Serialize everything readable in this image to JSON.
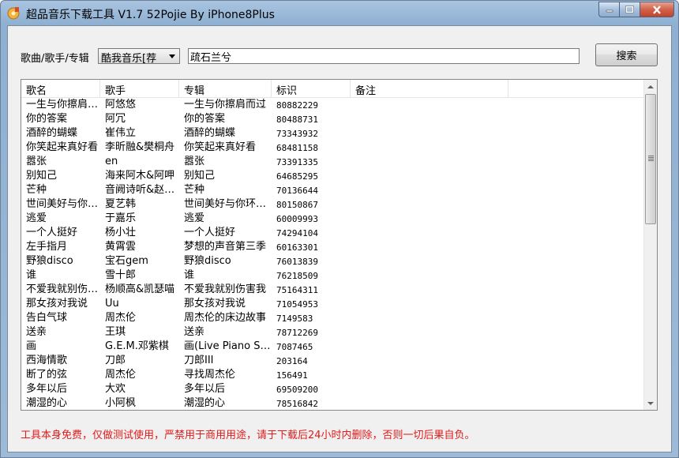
{
  "window": {
    "title": "超品音乐下载工具 V1.7 52Pojie By iPhone8Plus"
  },
  "search": {
    "label": "歌曲/歌手/专辑",
    "source_selected": "酷我音乐[荐",
    "query_value": "疏石兰兮",
    "button_label": "搜索"
  },
  "table": {
    "columns": [
      "歌名",
      "歌手",
      "专辑",
      "标识",
      "备注"
    ],
    "rows": [
      [
        "一生与你擦肩而过",
        "阿悠悠",
        "一生与你擦肩而过",
        "80882229",
        ""
      ],
      [
        "你的答案",
        "阿冗",
        "你的答案",
        "80488731",
        ""
      ],
      [
        "酒醉的蝴蝶",
        "崔伟立",
        "酒醉的蝴蝶",
        "73343932",
        ""
      ],
      [
        "你笑起来真好看",
        "李昕融&樊桐舟",
        "你笑起来真好看",
        "68481158",
        ""
      ],
      [
        "嚣张",
        "en",
        "嚣张",
        "73391335",
        ""
      ],
      [
        "别知己",
        "海来阿木&阿呷",
        "别知己",
        "64685295",
        ""
      ],
      [
        "芒种",
        "音阙诗听&赵方婧",
        "芒种",
        "70136644",
        ""
      ],
      [
        "世间美好与你环环相扣",
        "夏艺韩",
        "世间美好与你环环相扣",
        "80150867",
        ""
      ],
      [
        "逃爱",
        "于嘉乐",
        "逃爱",
        "60009993",
        ""
      ],
      [
        "一个人挺好",
        "杨小壮",
        "一个人挺好",
        "74294104",
        ""
      ],
      [
        "左手指月",
        "黄霄雲",
        "梦想的声音第三季",
        "60163301",
        ""
      ],
      [
        "野狼disco",
        "宝石gem",
        "野狼disco",
        "76013839",
        ""
      ],
      [
        "谁",
        "雪十郎",
        "谁",
        "76218509",
        ""
      ],
      [
        "不爱我就别伤害我",
        "杨顺高&凯瑟喵",
        "不爱我就别伤害我",
        "75164311",
        ""
      ],
      [
        "那女孩对我说",
        "Uu",
        "那女孩对我说",
        "71054953",
        ""
      ],
      [
        "告白气球",
        "周杰伦",
        "周杰伦的床边故事",
        "7149583",
        ""
      ],
      [
        "送亲",
        "王琪",
        "送亲",
        "78712269",
        ""
      ],
      [
        "画",
        "G.E.M.邓紫棋",
        "画(Live Piano Session II)",
        "7087465",
        ""
      ],
      [
        "西海情歌",
        "刀郎",
        "刀郎III",
        "203164",
        ""
      ],
      [
        "断了的弦",
        "周杰伦",
        "寻找周杰伦",
        "156491",
        ""
      ],
      [
        "多年以后",
        "大欢",
        "多年以后",
        "69509200",
        ""
      ],
      [
        "潮湿的心",
        "小阿枫",
        "潮湿的心",
        "78516842",
        ""
      ]
    ]
  },
  "footer": {
    "disclaimer": "工具本身免费，仅做测试使用，严禁用于商用用途，请于下载后24小时内删除，否则一切后果自负。"
  },
  "colors": {
    "disclaimer_text": "#e01b1b",
    "titlebar": "#9dbad8",
    "close_button": "#c4432a"
  },
  "icons": [
    "music-app-icon",
    "minimize-icon",
    "maximize-icon",
    "close-icon",
    "dropdown-arrow-icon",
    "scroll-up-icon",
    "scroll-down-icon",
    "scroll-grip-icon"
  ]
}
